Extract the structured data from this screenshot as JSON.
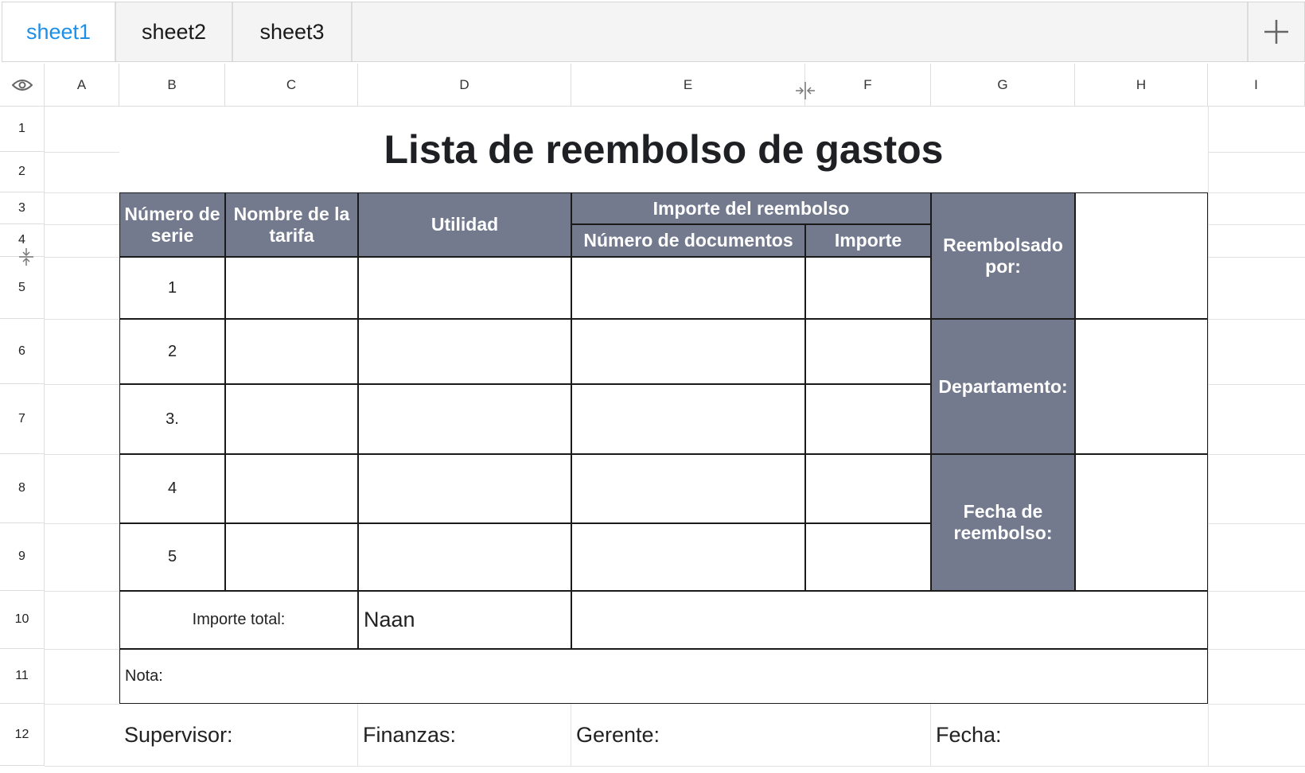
{
  "tabs": [
    {
      "label": "sheet1",
      "active": true
    },
    {
      "label": "sheet2",
      "active": false
    },
    {
      "label": "sheet3",
      "active": false
    }
  ],
  "columns": [
    "A",
    "B",
    "C",
    "D",
    "E",
    "F",
    "G",
    "H",
    "I"
  ],
  "rows": [
    "1",
    "2",
    "3",
    "4",
    "5",
    "6",
    "7",
    "8",
    "9",
    "10",
    "11",
    "12"
  ],
  "sheet": {
    "title": "Lista de reembolso de gastos",
    "headers": {
      "serial": "Número de serie",
      "fee_name": "Nombre de la tarifa",
      "utility": "Utilidad",
      "reimbursement_amount": "Importe del reembolso",
      "doc_count": "Número de documentos",
      "amount": "Importe"
    },
    "serials": [
      "1",
      "2",
      "3.",
      "4",
      "5"
    ],
    "side_labels": {
      "reimbursed_by": "Reembolsado por:",
      "department": "Departamento:",
      "date": "Fecha de reembolso:"
    },
    "total_label": "Importe total:",
    "total_value": "Naan",
    "note_label": "Nota:",
    "signatures": {
      "supervisor": "Supervisor:",
      "finance": "Finanzas:",
      "manager": "Gerente:",
      "date": "Fecha:"
    }
  },
  "colors": {
    "header_fill": "#737a8e",
    "active_tab": "#1e8fe6"
  }
}
